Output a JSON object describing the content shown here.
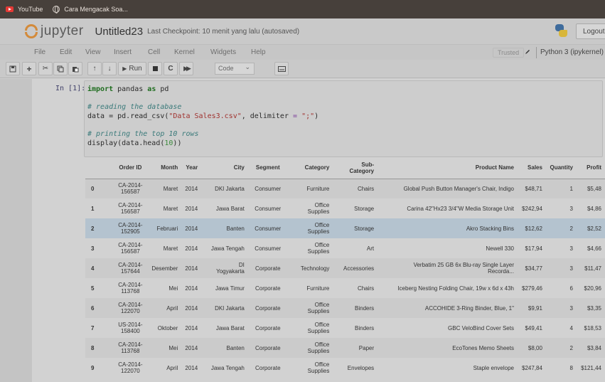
{
  "bookmarks": [
    {
      "label": "YouTube",
      "icon": "youtube-icon"
    },
    {
      "label": "Cara Mengacak Soa...",
      "icon": "globe-icon"
    }
  ],
  "header": {
    "logo_text": "jupyter",
    "notebook_title": "Untitled23",
    "checkpoint": "Last Checkpoint: 10 menit yang lalu  (autosaved)",
    "logout_label": "Logout"
  },
  "menu": {
    "items": [
      "File",
      "Edit",
      "View",
      "Insert",
      "Cell",
      "Kernel",
      "Widgets",
      "Help"
    ],
    "trusted": "Trusted",
    "kernel": "Python 3 (ipykernel)"
  },
  "toolbar": {
    "run_label": "Run",
    "cell_type": "Code"
  },
  "cell": {
    "prompt": "In [1]:",
    "code": {
      "line1": {
        "kw1": "import",
        "mod": " pandas ",
        "kw2": "as",
        "alias": " pd"
      },
      "comment1": "# reading the database",
      "line3": {
        "pre": "data = pd.read_csv(",
        "str1": "\"Data Sales3.csv\"",
        "mid": ", delimiter ",
        "eq": "=",
        "sp": " ",
        "str2": "\";\"",
        "post": ")"
      },
      "comment2": "# printing the top 10 rows",
      "line5": {
        "pre": "display(data.head(",
        "num": "10",
        "post": "))"
      }
    }
  },
  "table": {
    "headers": [
      "",
      "Order ID",
      "Month",
      "Year",
      "City",
      "Segment",
      "Category",
      "Sub-\nCategory",
      "Product Name",
      "Sales",
      "Quantity",
      "Profit"
    ],
    "rows": [
      [
        "0",
        "CA-2014-\n156587",
        "Maret",
        "2014",
        "DKI Jakarta",
        "Consumer",
        "Furniture",
        "Chairs",
        "Global Push Button Manager's Chair, Indigo",
        "$48,71",
        "1",
        "$5,48"
      ],
      [
        "1",
        "CA-2014-\n156587",
        "Maret",
        "2014",
        "Jawa Barat",
        "Consumer",
        "Office\nSupplies",
        "Storage",
        "Carina 42\"Hx23 3/4\"W Media Storage Unit",
        "$242,94",
        "3",
        "$4,86"
      ],
      [
        "2",
        "CA-2014-\n152905",
        "Februari",
        "2014",
        "Banten",
        "Consumer",
        "Office\nSupplies",
        "Storage",
        "Akro Stacking Bins",
        "$12,62",
        "2",
        "$2,52"
      ],
      [
        "3",
        "CA-2014-\n156587",
        "Maret",
        "2014",
        "Jawa Tengah",
        "Consumer",
        "Office\nSupplies",
        "Art",
        "Newell 330",
        "$17,94",
        "3",
        "$4,66"
      ],
      [
        "4",
        "CA-2014-\n157644",
        "Desember",
        "2014",
        "DI\nYogyakarta",
        "Corporate",
        "Technology",
        "Accessories",
        "Verbatim 25 GB 6x Blu-ray Single Layer\nRecorda...",
        "$34,77",
        "3",
        "$11,47"
      ],
      [
        "5",
        "CA-2014-\n113768",
        "Mei",
        "2014",
        "Jawa Timur",
        "Corporate",
        "Furniture",
        "Chairs",
        "Iceberg Nesting Folding Chair, 19w x 6d x 43h",
        "$279,46",
        "6",
        "$20,96"
      ],
      [
        "6",
        "CA-2014-\n122070",
        "April",
        "2014",
        "DKI Jakarta",
        "Corporate",
        "Office\nSupplies",
        "Binders",
        "ACCOHIDE 3-Ring Binder, Blue, 1\"",
        "$9,91",
        "3",
        "$3,35"
      ],
      [
        "7",
        "US-2014-\n158400",
        "Oktober",
        "2014",
        "Jawa Barat",
        "Corporate",
        "Office\nSupplies",
        "Binders",
        "GBC VeloBind Cover Sets",
        "$49,41",
        "4",
        "$18,53"
      ],
      [
        "8",
        "CA-2014-\n113768",
        "Mei",
        "2014",
        "Banten",
        "Corporate",
        "Office\nSupplies",
        "Paper",
        "EcoTones Memo Sheets",
        "$8,00",
        "2",
        "$3,84"
      ],
      [
        "9",
        "CA-2014-\n122070",
        "April",
        "2014",
        "Jawa Tengah",
        "Corporate",
        "Office\nSupplies",
        "Envelopes",
        "Staple envelope",
        "$247,84",
        "8",
        "$121,44"
      ]
    ],
    "highlighted_row": 2
  }
}
